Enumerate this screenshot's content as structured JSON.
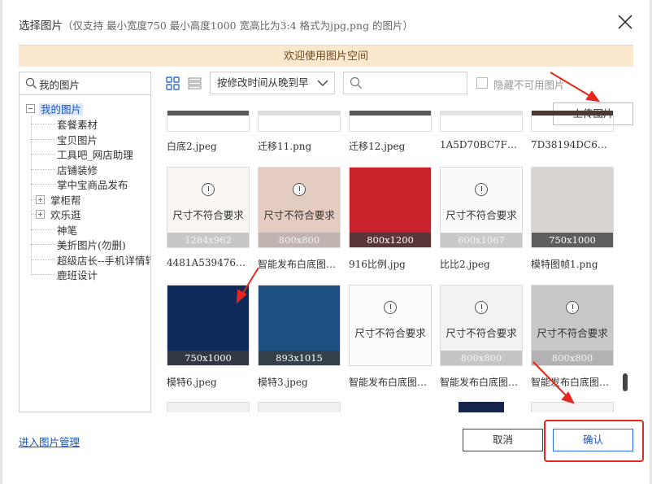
{
  "dialog": {
    "title": "选择图片",
    "subtitle": "（仅支持 最小宽度750 最小高度1000 宽高比为3:4 格式为jpg,png 的图片）",
    "banner": "欢迎使用图片空间"
  },
  "sidebar": {
    "search_value": "我的图片",
    "root": "我的图片",
    "items": [
      {
        "label": "套餐素材",
        "expandable": false
      },
      {
        "label": "宝贝图片",
        "expandable": false
      },
      {
        "label": "工具吧_网店助理",
        "expandable": false
      },
      {
        "label": "店铺装修",
        "expandable": false
      },
      {
        "label": "掌中宝商品发布",
        "expandable": false
      },
      {
        "label": "掌柜帮",
        "expandable": true
      },
      {
        "label": "欢乐逛",
        "expandable": true
      },
      {
        "label": "神笔",
        "expandable": false
      },
      {
        "label": "美折图片(勿删)",
        "expandable": false
      },
      {
        "label": "超级店长--手机详情转",
        "expandable": false
      },
      {
        "label": "鹿班设计",
        "expandable": false
      }
    ]
  },
  "toolbar": {
    "sort_value": "按修改时间从晚到早",
    "search_placeholder": "",
    "hide_unavailable_label": "隐藏不可用图片",
    "upload_label": "上传图片"
  },
  "grid": {
    "warning_text": "尺寸不符合要求",
    "row1": [
      {
        "name": "白底2.jpeg"
      },
      {
        "name": "迁移11.png"
      },
      {
        "name": "迁移12.jpeg"
      },
      {
        "name": "1A5D70BC7FBA…"
      },
      {
        "name": "7D38194DC6964…"
      }
    ],
    "row2": [
      {
        "name": "4481A539476E46…",
        "dims": "1284x962",
        "ok": false,
        "tone": "#e8dccf"
      },
      {
        "name": "智能发布白底图…",
        "dims": "800x800",
        "ok": false,
        "tone": "#a14a2a"
      },
      {
        "name": "916比例.jpg",
        "dims": "800x1200",
        "ok": true,
        "tone": "#c9222a"
      },
      {
        "name": "比比2.jpeg",
        "dims": "600x1067",
        "ok": false,
        "tone": "#ededed"
      },
      {
        "name": "模特图帧1.png",
        "dims": "750x1000",
        "ok": true,
        "tone": "#d9d4cf"
      }
    ],
    "row3": [
      {
        "name": "模特6.jpeg",
        "dims": "750x1000",
        "ok": true,
        "tone": "#0e2a5a"
      },
      {
        "name": "模特3.jpeg",
        "dims": "893x1015",
        "ok": true,
        "tone": "#1d4f80"
      },
      {
        "name": "智能发布白底图…",
        "dims": "",
        "ok": false,
        "tone": "#f2f2f2"
      },
      {
        "name": "智能发布白底图…",
        "dims": "800x800",
        "ok": false,
        "tone": "#d0d0d0"
      },
      {
        "name": "智能发布白底图…",
        "dims": "800x800",
        "ok": false,
        "tone": "#3a3a3a"
      }
    ]
  },
  "footer": {
    "manage_link": "进入图片管理",
    "cancel_label": "取消",
    "confirm_label": "确认"
  },
  "colors": {
    "banner_bg": "#fbe8cf",
    "link_blue": "#1a55c9",
    "annotation_red": "#e5271d"
  }
}
